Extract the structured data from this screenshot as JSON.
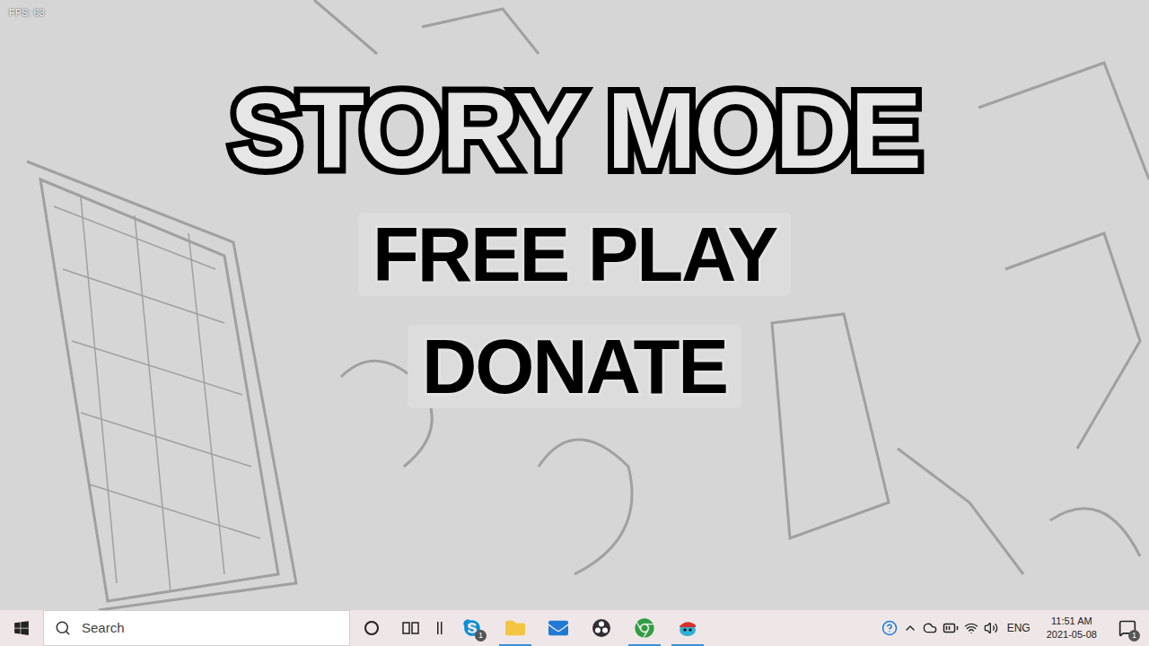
{
  "game": {
    "fps": "FPS: 63",
    "menu": [
      {
        "label": "STORY MODE",
        "selected": true
      },
      {
        "label": "FREE PLAY",
        "selected": false
      },
      {
        "label": "DONATE",
        "selected": false
      }
    ]
  },
  "taskbar": {
    "search": {
      "placeholder": "Search"
    },
    "apps": [
      {
        "kind": "skype",
        "badge": "1",
        "running": false
      },
      {
        "kind": "explorer",
        "badge": "",
        "running": true
      },
      {
        "kind": "mail",
        "badge": "",
        "running": false
      },
      {
        "kind": "obs",
        "badge": "",
        "running": false
      },
      {
        "kind": "chrome",
        "badge": "",
        "running": true
      },
      {
        "kind": "game",
        "badge": "",
        "running": true
      }
    ],
    "tray": {
      "language": "ENG",
      "time": "11:51 AM",
      "date": "2021-05-08",
      "notifications": "1"
    }
  }
}
